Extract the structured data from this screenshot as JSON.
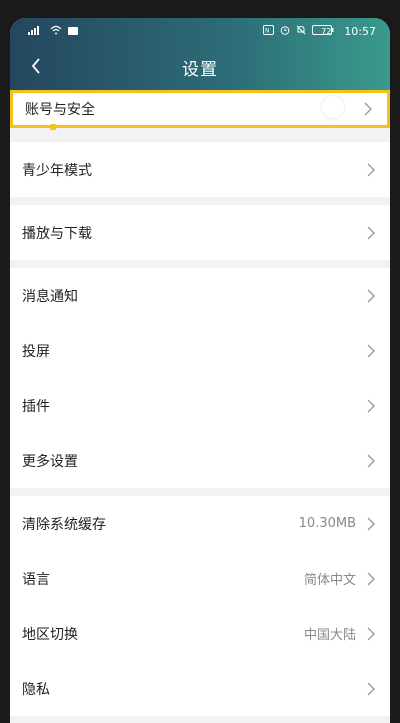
{
  "status_bar": {
    "battery": "72",
    "time": "10:57"
  },
  "header": {
    "title": "设置"
  },
  "groups": [
    {
      "items": [
        {
          "label": "账号与安全",
          "value": ""
        }
      ]
    },
    {
      "items": [
        {
          "label": "青少年模式",
          "value": ""
        }
      ]
    },
    {
      "items": [
        {
          "label": "播放与下载",
          "value": ""
        }
      ]
    },
    {
      "items": [
        {
          "label": "消息通知",
          "value": ""
        },
        {
          "label": "投屏",
          "value": ""
        },
        {
          "label": "插件",
          "value": ""
        },
        {
          "label": "更多设置",
          "value": ""
        }
      ]
    },
    {
      "items": [
        {
          "label": "清除系统缓存",
          "value": "10.30MB"
        },
        {
          "label": "语言",
          "value": "简体中文"
        },
        {
          "label": "地区切换",
          "value": "中国大陆"
        },
        {
          "label": "隐私",
          "value": ""
        }
      ]
    }
  ],
  "colors": {
    "focus_outline": "#f4c21a",
    "header_gradient_start": "#24475e",
    "header_gradient_end": "#3a9a8c"
  }
}
